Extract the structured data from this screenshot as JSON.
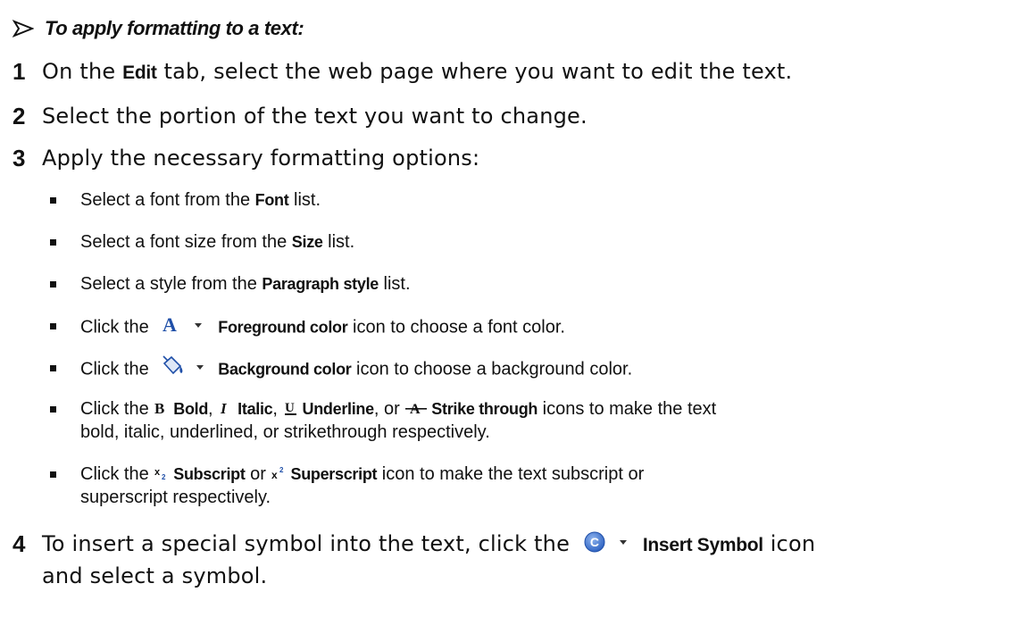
{
  "procedure_title": "To apply formatting to a text:",
  "steps": [
    {
      "num": "1",
      "pre": "On the ",
      "bold": "Edit",
      "post": " tab, select the web page where you want to edit the text."
    },
    {
      "num": "2",
      "text": "Select the portion of the text you want to change."
    },
    {
      "num": "3",
      "text": "Apply the necessary formatting options:"
    },
    {
      "num": "4",
      "line1_pre": "To insert a special symbol into the text, click the ",
      "line1_bold": "Insert Symbol",
      "line1_post": " icon",
      "line2": "and select a symbol."
    }
  ],
  "bullets": {
    "font": {
      "pre": "Select a font from the ",
      "bold": "Font",
      "post": " list."
    },
    "size": {
      "pre": "Select a font size from the ",
      "bold": "Size",
      "post": " list."
    },
    "style": {
      "pre": "Select a style from the ",
      "bold": "Paragraph style",
      "post": " list."
    },
    "foreground": {
      "pre": "Click the ",
      "bold": "Foreground color",
      "post": " icon to choose a font color."
    },
    "background": {
      "pre": "Click the ",
      "bold": "Background color",
      "post": " icon to choose a background color."
    },
    "styles": {
      "pre": "Click the ",
      "bold_label": "Bold",
      "sep1": ", ",
      "italic_label": "Italic",
      "sep2": ", ",
      "underline_label": "Underline",
      "sep3": ", or ",
      "strike_label": "Strike through",
      "post": " icons to make the text",
      "line2": "bold, italic, underlined, or strikethrough respectively."
    },
    "scripts": {
      "pre": "Click the ",
      "subscript_label": "Subscript",
      "mid": " or ",
      "superscript_label": "Superscript",
      "post": " icon to make the text subscript or",
      "line2": "superscript respectively."
    }
  },
  "icons": {
    "arrow": "arrow-right-icon",
    "foreground": "font-color-icon",
    "background": "fill-color-icon",
    "bold": "bold-icon",
    "italic": "italic-icon",
    "underline": "underline-icon",
    "strike": "strikethrough-icon",
    "subscript": "subscript-icon",
    "superscript": "superscript-icon",
    "symbol": "copyright-symbol-icon"
  },
  "colors": {
    "text": "#111111",
    "icon_blue": "#1f4fa8"
  }
}
